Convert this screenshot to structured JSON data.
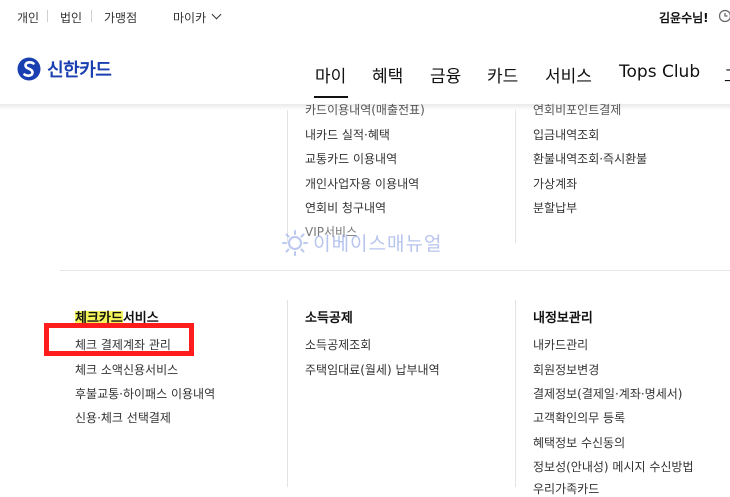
{
  "utility": {
    "personal": "개인",
    "corporate": "법인",
    "merchant": "가맹점",
    "my_car": "마이카",
    "user_greeting": "김윤수님!"
  },
  "brand": {
    "name": "신한카드",
    "color": "#1a3fb0"
  },
  "nav": {
    "items": [
      "마이",
      "혜택",
      "금융",
      "카드",
      "서비스",
      "Tops Club",
      "고"
    ],
    "active": "마이"
  },
  "submenu_top": {
    "col1": [
      "카드이용내역(매출전표)",
      "내카드 실적·혜택",
      "교통카드 이용내역",
      "개인사업자용 이용내역",
      "연회비 청구내역",
      "VIP서비스"
    ],
    "col2": [
      "연회비포인트결제",
      "입금내역조회",
      "환불내역조회·즉시환불",
      "가상계좌",
      "분할납부"
    ]
  },
  "sections": {
    "check": {
      "title_highlight": "체크카드",
      "title_rest": "서비스",
      "items": [
        "체크 결제계좌 관리",
        "체크 소액신용서비스",
        "후불교통·하이패스 이용내역",
        "신용·체크 선택결제"
      ]
    },
    "tax": {
      "title": "소득공제",
      "items": [
        "소득공제조회",
        "주택임대료(월세) 납부내역"
      ]
    },
    "info": {
      "title": "내정보관리",
      "items": [
        "내카드관리",
        "회원정보변경",
        "결제정보(결제일·계좌·명세서)",
        "고객확인의무 등록",
        "혜택정보 수신동의",
        "정보성(안내성) 메시지 수신방법",
        "우리가족카드"
      ]
    }
  },
  "watermark": {
    "text": "이베이스매뉴얼"
  },
  "colors": {
    "highlight": "#f3f35a",
    "annotation_box": "#ff1c1c"
  }
}
